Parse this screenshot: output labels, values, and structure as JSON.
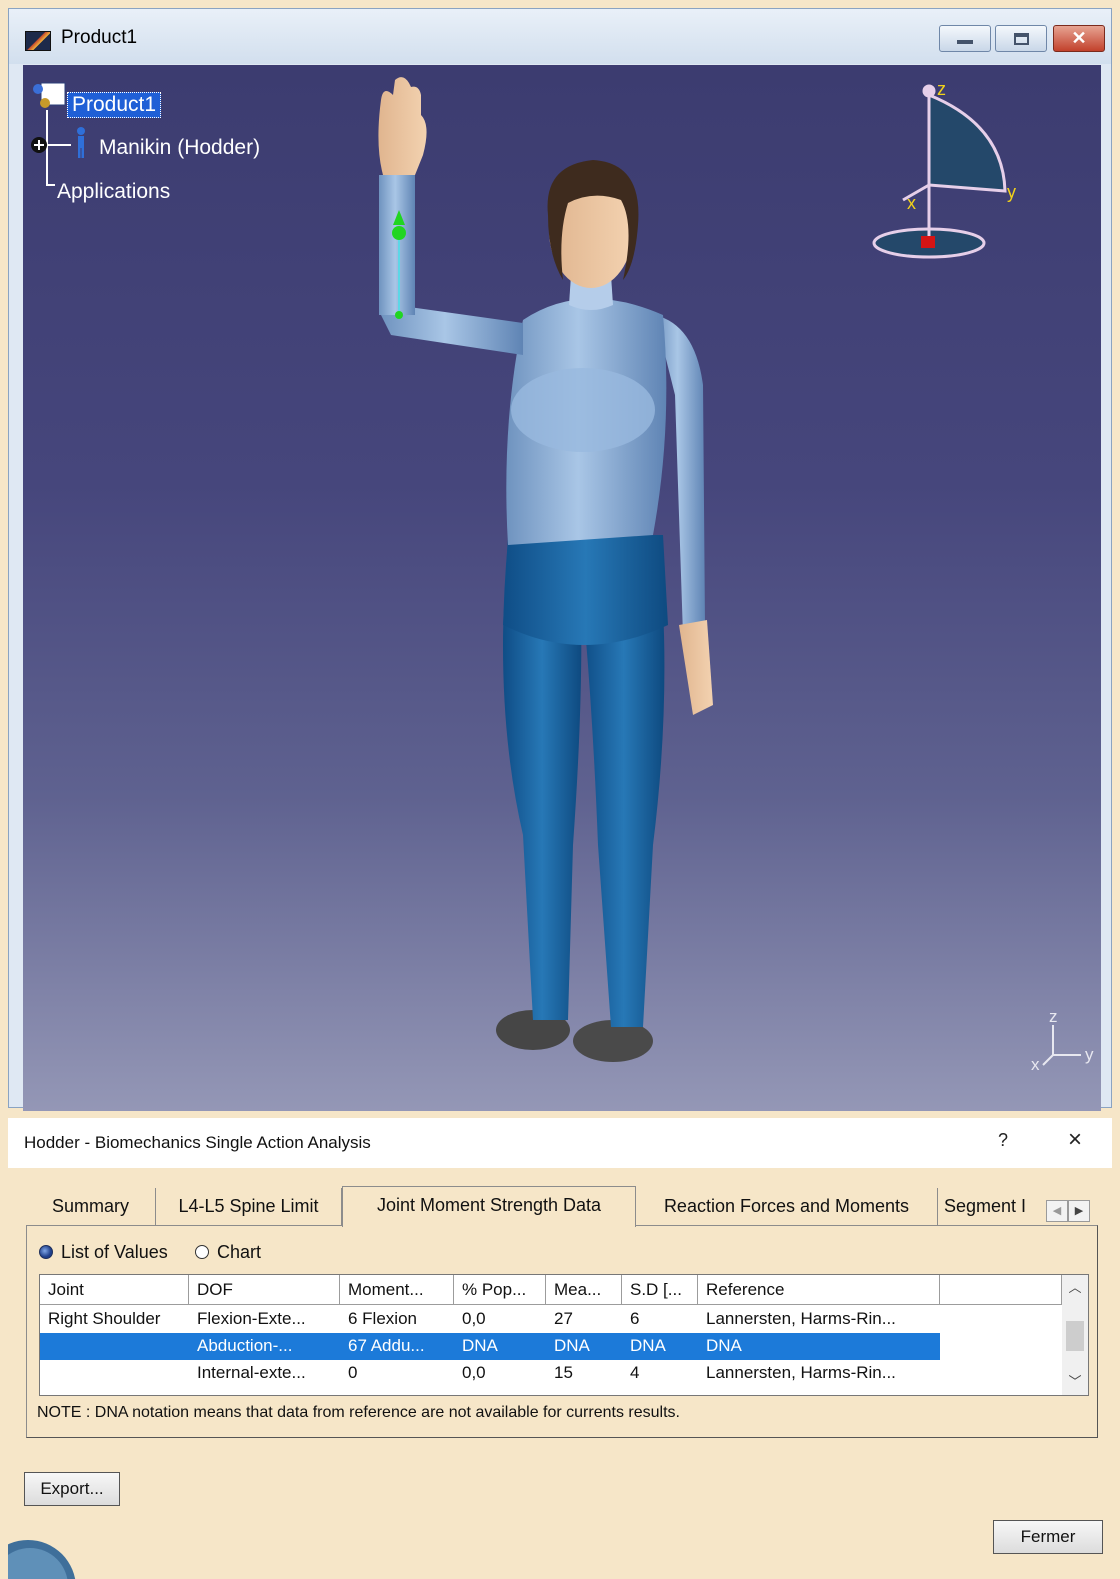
{
  "window": {
    "title": "Product1"
  },
  "tree": {
    "root": "Product1",
    "manikin": "Manikin (Hodder)",
    "applications": "Applications"
  },
  "compass": {
    "x": "x",
    "y": "y",
    "z": "z"
  },
  "mini_axis": {
    "x": "x",
    "y": "y",
    "z": "z"
  },
  "dialog": {
    "title": "Hodder - Biomechanics Single Action Analysis",
    "help": "?",
    "close": "×",
    "tabs": [
      {
        "label": "Summary",
        "active": false
      },
      {
        "label": "L4-L5 Spine Limit",
        "active": false
      },
      {
        "label": "Joint Moment Strength Data",
        "active": true
      },
      {
        "label": "Reaction Forces and Moments",
        "active": false
      },
      {
        "label": "Segment I",
        "active": false
      }
    ],
    "view_mode": {
      "list_label": "List of Values",
      "chart_label": "Chart",
      "selected": "List of Values"
    },
    "table": {
      "columns": [
        "Joint",
        "DOF",
        "Moment...",
        "% Pop...",
        "Mea...",
        "S.D [...",
        "Reference",
        ""
      ],
      "rows": [
        {
          "joint": "Right Shoulder",
          "dof": "Flexion-Exte...",
          "moment": "6 Flexion",
          "pop": "0,0",
          "mean": "27",
          "sd": "6",
          "reference": "Lannersten, Harms-Rin...",
          "selected": false
        },
        {
          "joint": "",
          "dof": "Abduction-...",
          "moment": "67 Addu...",
          "pop": "DNA",
          "mean": "DNA",
          "sd": "DNA",
          "reference": "DNA",
          "selected": true
        },
        {
          "joint": "",
          "dof": "Internal-exte...",
          "moment": "0",
          "pop": "0,0",
          "mean": "15",
          "sd": "4",
          "reference": "Lannersten, Harms-Rin...",
          "selected": false
        }
      ]
    },
    "note": "NOTE : DNA notation means that data from reference are not available for currents results.",
    "export_label": "Export...",
    "close_label": "Fermer"
  }
}
